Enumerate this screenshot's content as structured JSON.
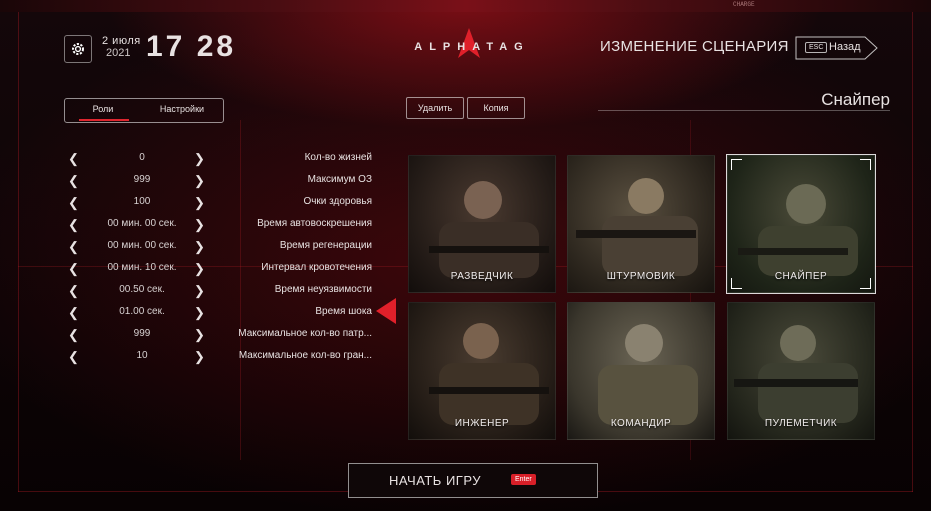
{
  "colors": {
    "accent": "#e0202a",
    "background": "#070203",
    "text": "#e8e2e2"
  },
  "top_strip": {
    "items": [
      "CHARGE"
    ]
  },
  "header": {
    "settings_icon": "gear-icon",
    "date_day": "2 июля",
    "date_year": "2021",
    "time": "17 28",
    "brand": "ALPHATAG",
    "screen_title": "ИЗМЕНЕНИЕ СЦЕНАРИЯ",
    "back": {
      "key": "ESC",
      "label": "Назад"
    }
  },
  "tabs": {
    "roles": "Роли",
    "settings": "Настройки"
  },
  "actions": {
    "delete": "Удалить",
    "copy": "Копия"
  },
  "scenario_name": "Снайпер",
  "settings": [
    {
      "label": "Кол-во жизней",
      "value": "0"
    },
    {
      "label": "Максимум ОЗ",
      "value": "999"
    },
    {
      "label": "Очки здоровья",
      "value": "100"
    },
    {
      "label": "Время автовоскрешения",
      "value": "00 мин. 00 сек."
    },
    {
      "label": "Время регенерации",
      "value": "00 мин. 00 сек."
    },
    {
      "label": "Интервал кровотечения",
      "value": "00 мин. 10 сек."
    },
    {
      "label": "Время неуязвимости",
      "value": "00.50 сек."
    },
    {
      "label": "Время шока",
      "value": "01.00 сек."
    },
    {
      "label": "Максимальное кол-во патр...",
      "value": "999"
    },
    {
      "label": "Максимальное кол-во гран...",
      "value": "10"
    }
  ],
  "selected_setting_index": 7,
  "roles": [
    {
      "name": "СНАЙПЕР",
      "selected": true
    },
    {
      "name": "ШТУРМОВИК",
      "selected": false
    },
    {
      "name": "РАЗВЕДЧИК",
      "selected": false
    },
    {
      "name": "ПУЛЕМЕТЧИК",
      "selected": false
    },
    {
      "name": "КОМАНДИР",
      "selected": false
    },
    {
      "name": "ИНЖЕНЕР",
      "selected": false
    }
  ],
  "start": {
    "key": "Enter",
    "label": "НАЧАТЬ ИГРУ"
  }
}
